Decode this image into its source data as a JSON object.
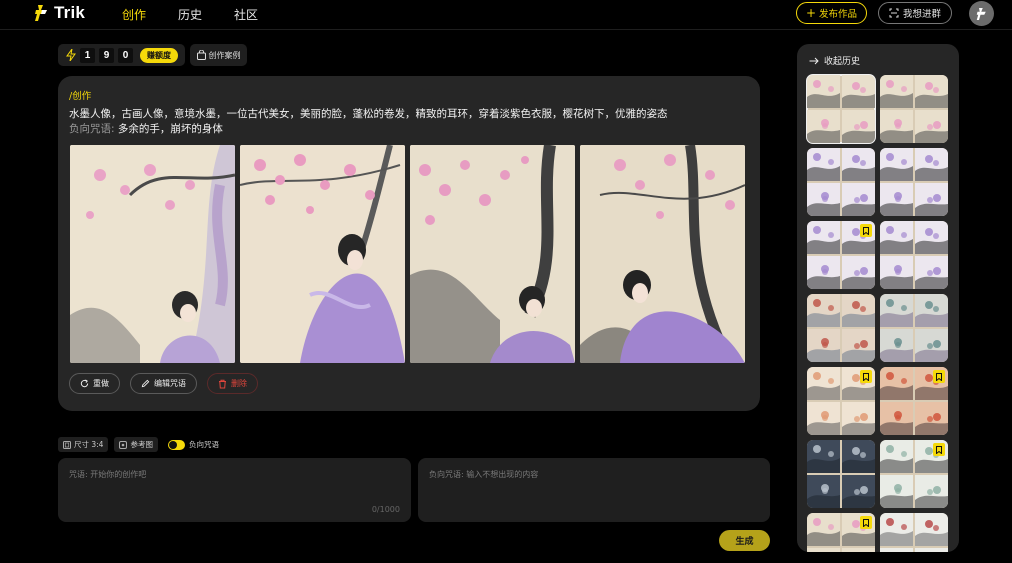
{
  "app": {
    "name": "Trik"
  },
  "nav": {
    "items": [
      {
        "label": "创作",
        "active": true
      },
      {
        "label": "历史",
        "active": false
      },
      {
        "label": "社区",
        "active": false
      }
    ]
  },
  "header": {
    "publish_label": "发布作品",
    "join_label": "我想进群"
  },
  "credits": {
    "digits": [
      "1",
      "9",
      "0"
    ],
    "earn_label": "赚额度",
    "cases_label": "创作案例"
  },
  "result": {
    "tag": "/创作",
    "prompt": "水墨人像，古画人像，意境水墨，一位古代美女，美丽的脸，蓬松的卷发，精致的耳环，穿着淡紫色衣服，樱花树下，优雅的姿态",
    "negative_label": "负向咒语:",
    "negative_text": "多余的手，崩坏的身体",
    "actions": {
      "redo": "重做",
      "edit": "编辑咒语",
      "delete": "删除"
    }
  },
  "options": {
    "size_label": "尺寸 3:4",
    "reference_label": "参考图",
    "negative_toggle_label": "负向咒语",
    "negative_toggle_on": true
  },
  "inputs": {
    "prompt_placeholder": "咒语: 开始你的创作吧",
    "prompt_count": "0/1000",
    "negative_placeholder": "负向咒语: 输入不想出现的内容"
  },
  "generate_label": "生成",
  "history": {
    "title": "收起历史",
    "tiles": [
      {
        "theme": "blossom",
        "bookmarked": false,
        "selected": true
      },
      {
        "theme": "blossom",
        "bookmarked": false,
        "selected": false
      },
      {
        "theme": "lady",
        "bookmarked": false,
        "selected": false
      },
      {
        "theme": "lady",
        "bookmarked": false,
        "selected": false
      },
      {
        "theme": "lady",
        "bookmarked": true,
        "selected": false
      },
      {
        "theme": "lady",
        "bookmarked": false,
        "selected": false
      },
      {
        "theme": "mountain-red",
        "bookmarked": false,
        "selected": false
      },
      {
        "theme": "mountain-teal",
        "bookmarked": false,
        "selected": false
      },
      {
        "theme": "sunset",
        "bookmarked": true,
        "selected": false
      },
      {
        "theme": "sunset-red",
        "bookmarked": true,
        "selected": false
      },
      {
        "theme": "room",
        "bookmarked": false,
        "selected": false
      },
      {
        "theme": "birds",
        "bookmarked": true,
        "selected": false
      },
      {
        "theme": "blossom",
        "bookmarked": true,
        "selected": false
      },
      {
        "theme": "pagoda",
        "bookmarked": false,
        "selected": false
      }
    ]
  },
  "colors": {
    "accent": "#f5d90a",
    "card_bg": "#262626",
    "panel_bg": "#1f1f1f",
    "danger": "#e0453c"
  }
}
